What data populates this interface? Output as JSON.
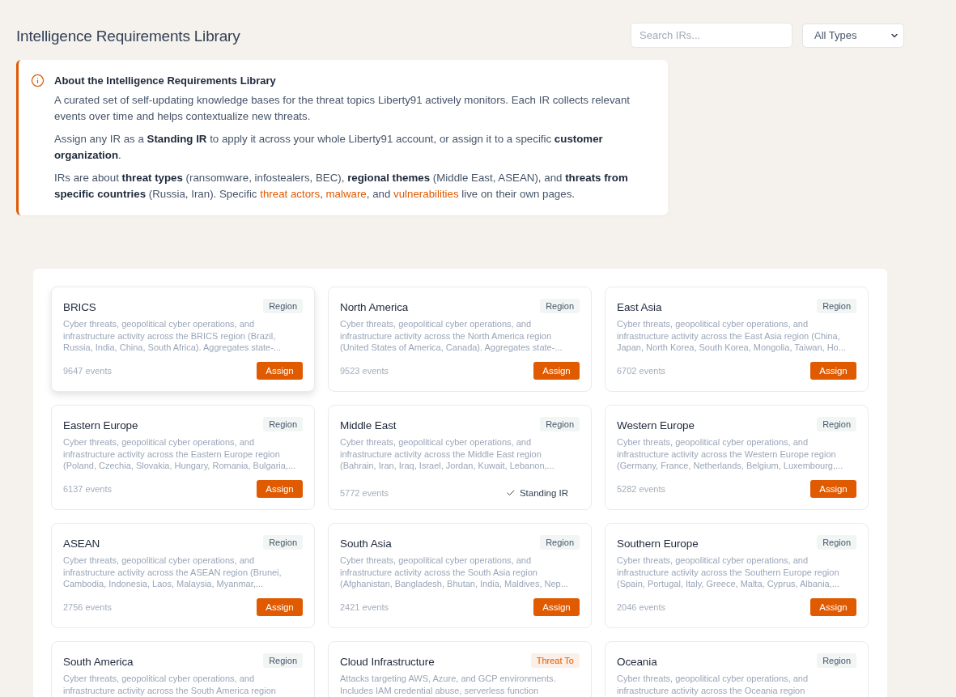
{
  "page": {
    "title": "Intelligence Requirements Library"
  },
  "search": {
    "placeholder": "Search IRs..."
  },
  "type_filter": {
    "value": "All Types"
  },
  "about": {
    "title": "About the Intelligence Requirements Library",
    "paragraphs": [
      [
        {
          "kind": "text",
          "text": "A curated set of self-updating knowledge bases for the threat topics Liberty91 actively monitors. Each IR collects relevant events over time and helps contextualize new threats."
        }
      ],
      [
        {
          "kind": "text",
          "text": "Assign any IR as a **Standing IR** to apply it across your whole Liberty91 account, or assign it to a specific **customer organization**."
        }
      ],
      [
        {
          "kind": "text",
          "text": "IRs are about **threat types** (ransomware, infostealers, BEC), **regional themes** (Middle East, ASEAN), and **threats from specific countries** (Russia, Iran). Specific "
        },
        {
          "kind": "link",
          "text": "threat actors"
        },
        {
          "kind": "text",
          "text": ", "
        },
        {
          "kind": "link",
          "text": "malware"
        },
        {
          "kind": "text",
          "text": ", and "
        },
        {
          "kind": "link",
          "text": "vulnerabilities"
        },
        {
          "kind": "text",
          "text": " live on their own pages."
        }
      ]
    ]
  },
  "cards": [
    {
      "title": "BRICS",
      "badge": "Region",
      "kind": "plain",
      "hovered": true,
      "description": "Cyber threats, geopolitical cyber operations, and infrastructure activity across the BRICS region (Brazil, Russia, India, China, South Africa). Aggregates state-...",
      "events": "9647 events",
      "standing": false,
      "action_label": "Assign"
    },
    {
      "title": "North America",
      "badge": "Region",
      "kind": "plain",
      "hovered": false,
      "description": "Cyber threats, geopolitical cyber operations, and infrastructure activity across the North America region (United States of America, Canada). Aggregates state-...",
      "events": "9523 events",
      "standing": false,
      "action_label": "Assign"
    },
    {
      "title": "East Asia",
      "badge": "Region",
      "kind": "plain",
      "hovered": false,
      "description": "Cyber threats, geopolitical cyber operations, and infrastructure activity across the East Asia region (China, Japan, North Korea, South Korea, Mongolia, Taiwan, Ho...",
      "events": "6702 events",
      "standing": false,
      "action_label": "Assign"
    },
    {
      "title": "Eastern Europe",
      "badge": "Region",
      "kind": "plain",
      "hovered": false,
      "description": "Cyber threats, geopolitical cyber operations, and infrastructure activity across the Eastern Europe region (Poland, Czechia, Slovakia, Hungary, Romania, Bulgaria,...",
      "events": "6137 events",
      "standing": false,
      "action_label": "Assign"
    },
    {
      "title": "Middle East",
      "badge": "Region",
      "kind": "plain",
      "hovered": false,
      "description": "Cyber threats, geopolitical cyber operations, and infrastructure activity across the Middle East region (Bahrain, Iran, Iraq, Israel, Jordan, Kuwait, Lebanon,...",
      "events": "5772 events",
      "standing": true,
      "action_label": "Standing IR"
    },
    {
      "title": "Western Europe",
      "badge": "Region",
      "kind": "plain",
      "hovered": false,
      "description": "Cyber threats, geopolitical cyber operations, and infrastructure activity across the Western Europe region (Germany, France, Netherlands, Belgium, Luxembourg,...",
      "events": "5282 events",
      "standing": false,
      "action_label": "Assign"
    },
    {
      "title": "ASEAN",
      "badge": "Region",
      "kind": "plain",
      "hovered": false,
      "description": "Cyber threats, geopolitical cyber operations, and infrastructure activity across the ASEAN region (Brunei, Cambodia, Indonesia, Laos, Malaysia, Myanmar,...",
      "events": "2756 events",
      "standing": false,
      "action_label": "Assign"
    },
    {
      "title": "South Asia",
      "badge": "Region",
      "kind": "plain",
      "hovered": false,
      "description": "Cyber threats, geopolitical cyber operations, and infrastructure activity across the South Asia region (Afghanistan, Bangladesh, Bhutan, India, Maldives, Nep...",
      "events": "2421 events",
      "standing": false,
      "action_label": "Assign"
    },
    {
      "title": "Southern Europe",
      "badge": "Region",
      "kind": "plain",
      "hovered": false,
      "description": "Cyber threats, geopolitical cyber operations, and infrastructure activity across the Southern Europe region (Spain, Portugal, Italy, Greece, Malta, Cyprus, Albania,...",
      "events": "2046 events",
      "standing": false,
      "action_label": "Assign"
    },
    {
      "title": "South America",
      "badge": "Region",
      "kind": "plain",
      "description": "Cyber threats, geopolitical cyber operations, and infrastructure activity across the South America region"
    },
    {
      "title": "Cloud Infrastructure",
      "badge": "Threat To",
      "kind": "accent",
      "description": "Attacks targeting AWS, Azure, and GCP environments. Includes IAM credential abuse, serverless function"
    },
    {
      "title": "Oceania",
      "badge": "Region",
      "kind": "plain",
      "description": "Cyber threats, geopolitical cyber operations, and infrastructure activity across the Oceania region"
    }
  ]
}
